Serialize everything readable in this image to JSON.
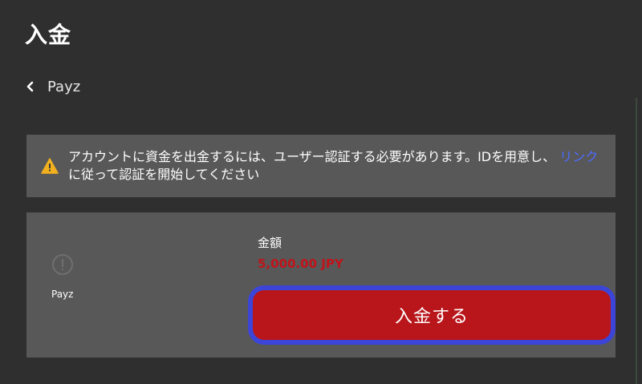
{
  "page": {
    "title": "入金"
  },
  "nav": {
    "back_label": "Payz"
  },
  "alert": {
    "text_before": "アカウントに資金を出金するには、ユーザー認証する必要があります。IDを用意し、",
    "link_text": "リンク",
    "text_after": "に従って認証を開始してください"
  },
  "payment": {
    "method_name": "Payz",
    "amount_label": "金額",
    "amount_value": "5,000.00 JPY",
    "deposit_button": "入金する"
  },
  "colors": {
    "background": "#2f2f2f",
    "panel": "#585858",
    "accent_red": "#b9161b",
    "amount_red": "#c0141a",
    "link_blue": "#4d6bff",
    "focus_ring": "#3c45d8",
    "warning_yellow": "#f2b01e"
  },
  "icons": {
    "back": "chevron-left-icon",
    "warning": "warning-triangle-icon",
    "payment_method": "info-circle-icon"
  }
}
